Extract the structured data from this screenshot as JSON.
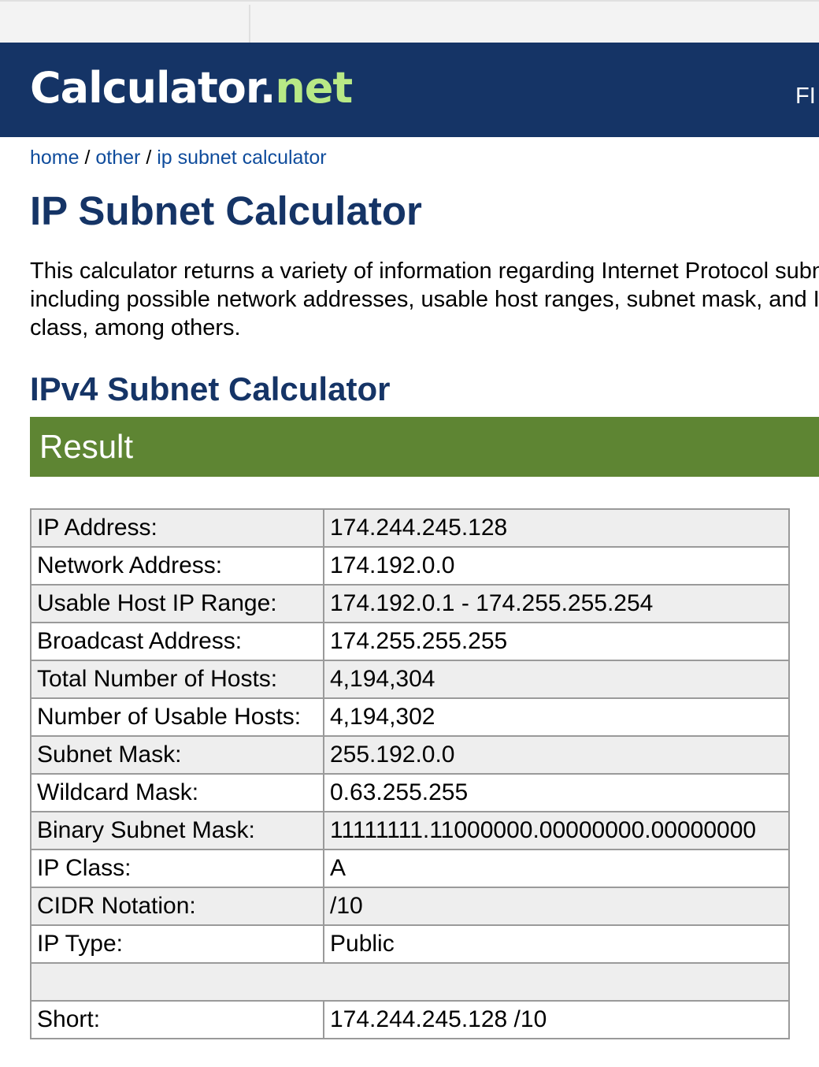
{
  "header": {
    "logo_main": "Calculator",
    "logo_dot": ".",
    "logo_net": "net",
    "right_text": "FI"
  },
  "breadcrumb": {
    "home": "home",
    "sep1": " / ",
    "other": "other",
    "sep2": " / ",
    "current": "ip subnet calculator"
  },
  "page_title": "IP Subnet Calculator",
  "intro": "This calculator returns a variety of information regarding Internet Protocol subnets including possible network addresses, usable host ranges, subnet mask, and IP class, among others.",
  "section_title": "IPv4 Subnet Calculator",
  "result_label": "Result",
  "colors": {
    "header_bg": "#153466",
    "logo_net": "#b8e986",
    "link": "#0f4c9c",
    "result_bar": "#5e8533"
  },
  "results": [
    {
      "label": "IP Address:",
      "value": "174.244.245.128"
    },
    {
      "label": "Network Address:",
      "value": "174.192.0.0"
    },
    {
      "label": "Usable Host IP Range:",
      "value": "174.192.0.1 - 174.255.255.254"
    },
    {
      "label": "Broadcast Address:",
      "value": "174.255.255.255"
    },
    {
      "label": "Total Number of Hosts:",
      "value": "4,194,304"
    },
    {
      "label": "Number of Usable Hosts:",
      "value": "4,194,302"
    },
    {
      "label": "Subnet Mask:",
      "value": "255.192.0.0"
    },
    {
      "label": "Wildcard Mask:",
      "value": "0.63.255.255"
    },
    {
      "label": "Binary Subnet Mask:",
      "value": "11111111.11000000.00000000.00000000"
    },
    {
      "label": "IP Class:",
      "value": "A"
    },
    {
      "label": "CIDR Notation:",
      "value": "/10"
    },
    {
      "label": "IP Type:",
      "value": "Public"
    }
  ],
  "short": {
    "label": "Short:",
    "value": "174.244.245.128 /10"
  }
}
